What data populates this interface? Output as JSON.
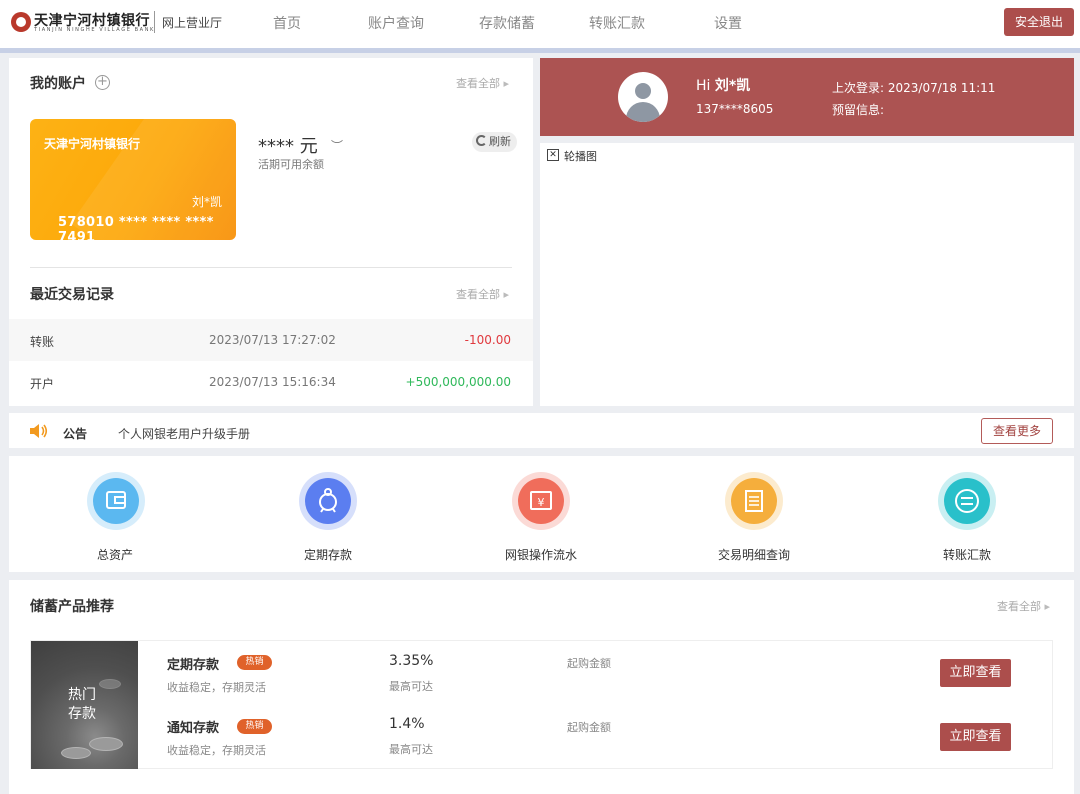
{
  "header": {
    "bank_name_cn": "天津宁河村镇银行",
    "bank_name_en": "TIANJIN NINGHE VILLAGE BANK",
    "portal": "网上营业厅",
    "nav": [
      "首页",
      "账户查询",
      "存款储蓄",
      "转账汇款",
      "设置"
    ],
    "logout": "安全退出"
  },
  "account": {
    "title": "我的账户",
    "view_all": "查看全部",
    "card": {
      "bank": "天津宁河村镇银行",
      "holder": "刘*凯",
      "number": "578010 **** **** **** 7491"
    },
    "balance": "**** 元",
    "balance_label": "活期可用余额",
    "refresh": "刷新"
  },
  "transactions": {
    "title": "最近交易记录",
    "view_all": "查看全部",
    "rows": [
      {
        "type": "转账",
        "time": "2023/07/13 17:27:02",
        "amount": "-100.00"
      },
      {
        "type": "开户",
        "time": "2023/07/13 15:16:34",
        "amount": "+500,000,000.00"
      }
    ]
  },
  "profile": {
    "greeting": "Hi ",
    "name": "刘*凯",
    "phone": "137****8605",
    "last_login_label": "上次登录: ",
    "last_login": "2023/07/18 11:11",
    "reserved_info": "预留信息:"
  },
  "carousel": {
    "alt": "轮播图"
  },
  "notice": {
    "label": "公告",
    "text": "个人网银老用户升级手册",
    "more": "查看更多"
  },
  "quick_links": [
    {
      "label": "总资产",
      "icon": "wallet-icon",
      "color": "#5bb8f0"
    },
    {
      "label": "定期存款",
      "icon": "piggy-bank-icon",
      "color": "#5b7ef0"
    },
    {
      "label": "网银操作流水",
      "icon": "receipt-icon",
      "color": "#f06d5b"
    },
    {
      "label": "交易明细查询",
      "icon": "document-list-icon",
      "color": "#f5ae3c"
    },
    {
      "label": "转账汇款",
      "icon": "transfer-icon",
      "color": "#29c0ca"
    }
  ],
  "products": {
    "title": "储蓄产品推荐",
    "view_all": "查看全部",
    "image_text_1": "热门",
    "image_text_2": "存款",
    "items": [
      {
        "name": "定期存款",
        "badge": "热销",
        "desc": "收益稳定，存期灵活",
        "rate": "3.35%",
        "rate_label": "最高可达",
        "min_label": "起购金额",
        "button": "立即查看"
      },
      {
        "name": "通知存款",
        "badge": "热销",
        "desc": "收益稳定，存期灵活",
        "rate": "1.4%",
        "rate_label": "最高可达",
        "min_label": "起购金额",
        "button": "立即查看"
      }
    ]
  },
  "colors": {
    "brand": "#ac4e4c",
    "negative": "#e0393e",
    "positive": "#2fb85a"
  }
}
